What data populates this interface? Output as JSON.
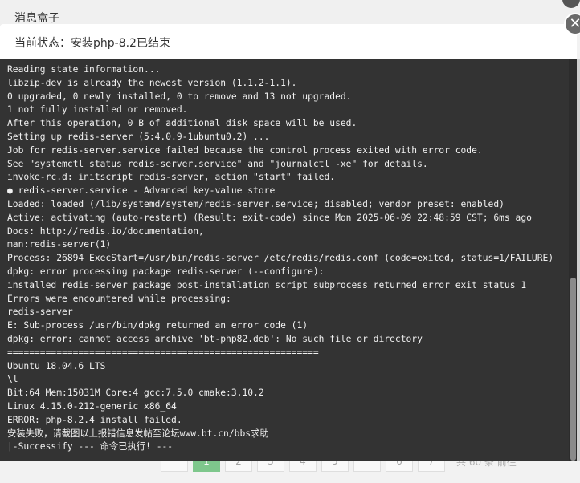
{
  "layer": {
    "title": "消息盒子",
    "status": "当前状态：安装php-8.2已结束",
    "close_label": "✕"
  },
  "console": {
    "lines": [
      "Reading state information...",
      "libzip-dev is already the newest version (1.1.2-1.1).",
      "0 upgraded, 0 newly installed, 0 to remove and 13 not upgraded.",
      "1 not fully installed or removed.",
      "After this operation, 0 B of additional disk space will be used.",
      "Setting up redis-server (5:4.0.9-1ubuntu0.2) ...",
      "Job for redis-server.service failed because the control process exited with error code.",
      "See \"systemctl status redis-server.service\" and \"journalctl -xe\" for details.",
      "invoke-rc.d: initscript redis-server, action \"start\" failed.",
      "● redis-server.service - Advanced key-value store",
      "Loaded: loaded (/lib/systemd/system/redis-server.service; disabled; vendor preset: enabled)",
      "Active: activating (auto-restart) (Result: exit-code) since Mon 2025-06-09 22:48:59 CST; 6ms ago",
      "Docs: http://redis.io/documentation,",
      "man:redis-server(1)",
      "Process: 26894 ExecStart=/usr/bin/redis-server /etc/redis/redis.conf (code=exited, status=1/FAILURE)",
      "dpkg: error processing package redis-server (--configure):",
      "installed redis-server package post-installation script subprocess returned error exit status 1",
      "Errors were encountered while processing:",
      "redis-server",
      "E: Sub-process /usr/bin/dpkg returned an error code (1)",
      "dpkg: error: cannot access archive 'bt-php82.deb': No such file or directory",
      "=========================================================",
      "Ubuntu 18.04.6 LTS",
      "\\l",
      "Bit:64 Mem:15031M Core:4 gcc:7.5.0 cmake:3.10.2",
      "Linux 4.15.0-212-generic x86_64",
      "ERROR: php-8.2.4 install failed.",
      "安装失败，请截图以上报错信息发帖至论坛www.bt.cn/bbs求助",
      "|-Successify --- 命令已执行! ---"
    ]
  },
  "background": {
    "pagination": {
      "pages": [
        "",
        "1",
        "2",
        "3",
        "4",
        "5",
        "",
        "6",
        "7"
      ],
      "summary": "共 60 条  前往"
    }
  },
  "colors": {
    "console_bg": "#333333",
    "console_text": "#f0f0f0",
    "accent": "#20a53a"
  }
}
